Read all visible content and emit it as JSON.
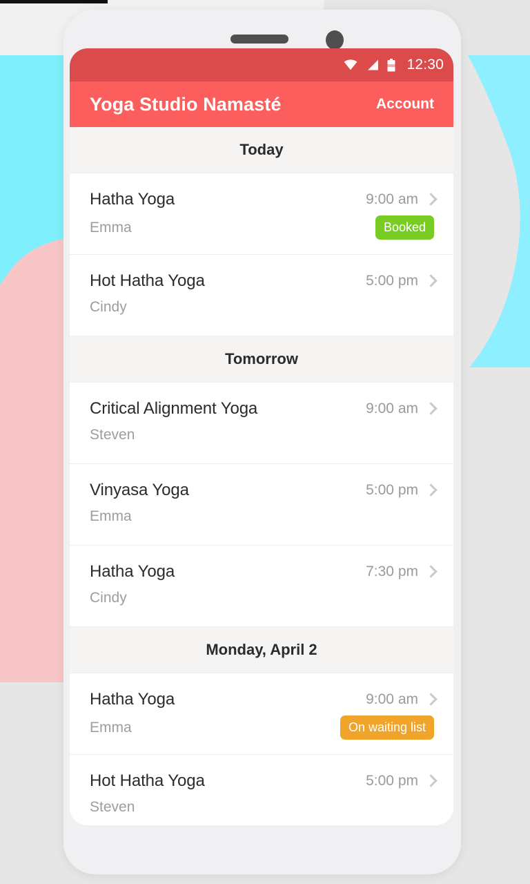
{
  "status_bar": {
    "time": "12:30",
    "icons": [
      "wifi-icon",
      "cellular-signal-icon",
      "battery-icon"
    ]
  },
  "app_bar": {
    "title": "Yoga Studio Namasté",
    "account_label": "Account"
  },
  "colors": {
    "status_bar": "#db4b4b",
    "app_bar": "#fc5d5d",
    "badge_booked": "#79cc23",
    "badge_waiting": "#f0a429",
    "section_header_bg": "#f5f4f2",
    "decor_cyan": "#8defff",
    "decor_pink": "#f9c6c8"
  },
  "sections": [
    {
      "header": "Today",
      "rows": [
        {
          "title": "Hatha Yoga",
          "teacher": "Emma",
          "time": "9:00 am",
          "badge": "Booked",
          "badge_type": "booked",
          "chevron": "chevron-right-icon"
        },
        {
          "title": "Hot Hatha Yoga",
          "teacher": "Cindy",
          "time": "5:00 pm",
          "badge": "",
          "badge_type": "",
          "chevron": "chevron-right-icon"
        }
      ]
    },
    {
      "header": "Tomorrow",
      "rows": [
        {
          "title": "Critical Alignment Yoga",
          "teacher": "Steven",
          "time": "9:00 am",
          "badge": "",
          "badge_type": "",
          "chevron": "chevron-right-icon"
        },
        {
          "title": "Vinyasa Yoga",
          "teacher": "Emma",
          "time": "5:00 pm",
          "badge": "",
          "badge_type": "",
          "chevron": "chevron-right-icon"
        },
        {
          "title": "Hatha Yoga",
          "teacher": "Cindy",
          "time": "7:30 pm",
          "badge": "",
          "badge_type": "",
          "chevron": "chevron-right-icon"
        }
      ]
    },
    {
      "header": "Monday, April 2",
      "rows": [
        {
          "title": "Hatha Yoga",
          "teacher": "Emma",
          "time": "9:00 am",
          "badge": "On waiting list",
          "badge_type": "waiting",
          "chevron": "chevron-right-icon"
        },
        {
          "title": "Hot Hatha Yoga",
          "teacher": "Steven",
          "time": "5:00 pm",
          "badge": "",
          "badge_type": "",
          "chevron": "chevron-right-icon"
        }
      ]
    }
  ]
}
